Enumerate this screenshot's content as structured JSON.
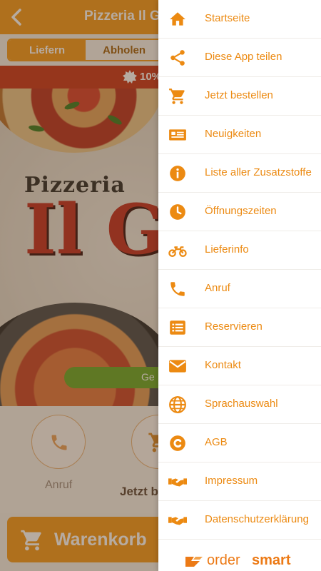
{
  "app": {
    "title": "Pizzeria Il Gus",
    "tabs": [
      "Liefern",
      "Abholen"
    ],
    "active_tab": "Liefern",
    "promo_text": "10%",
    "brand_line1": "Pizzeria",
    "brand_line2": "Il Gu",
    "green_pill_text": "Ge",
    "actions": [
      {
        "label": "Anruf",
        "icon": "phone-icon"
      },
      {
        "label": "Jetzt b",
        "icon": "cart-icon"
      }
    ],
    "cart_label": "Warenkorb"
  },
  "drawer": {
    "items": [
      {
        "label": "Startseite",
        "icon": "home-icon"
      },
      {
        "label": "Diese App teilen",
        "icon": "share-icon"
      },
      {
        "label": "Jetzt bestellen",
        "icon": "cart-icon"
      },
      {
        "label": "Neuigkeiten",
        "icon": "newspaper-icon"
      },
      {
        "label": "Liste aller Zusatzstoffe",
        "icon": "info-icon"
      },
      {
        "label": "Öffnungszeiten",
        "icon": "clock-icon"
      },
      {
        "label": "Lieferinfo",
        "icon": "motorcycle-icon"
      },
      {
        "label": "Anruf",
        "icon": "phone-icon"
      },
      {
        "label": "Reservieren",
        "icon": "list-icon"
      },
      {
        "label": "Kontakt",
        "icon": "envelope-icon"
      },
      {
        "label": "Sprachauswahl",
        "icon": "globe-icon"
      },
      {
        "label": "AGB",
        "icon": "copyright-icon"
      },
      {
        "label": "Impressum",
        "icon": "handshake-icon"
      },
      {
        "label": "Datenschutzerklärung",
        "icon": "handshake-icon"
      }
    ],
    "logo": {
      "text_a": "order",
      "text_b": "smart"
    }
  },
  "colors": {
    "accent": "#f39a1c",
    "menu_text": "#ec8a12",
    "promo_red": "#c8361a",
    "green": "#6aa829"
  }
}
